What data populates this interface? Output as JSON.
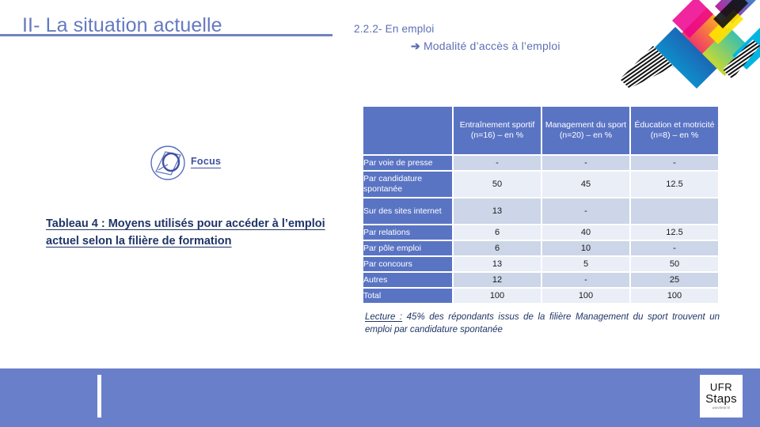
{
  "slide": {
    "title": "II- La situation actuelle",
    "subtitle_number": "2.2.2- En emploi",
    "subtitle_detail": "Modalité d’accès à l’emploi",
    "arrow_glyph": "➔",
    "focus_label": "Focus",
    "table_caption": "Tableau 4 : Moyens utilisés pour accéder à l’emploi actuel selon la filière de formation",
    "lecture_label": "Lecture :",
    "lecture_text": " 45% des répondants issus de la filière Management du sport trouvent un emploi par candidature spontanée"
  },
  "table": {
    "corner_header": "",
    "columns": [
      "Entraînement sportif (n=16) – en %",
      "Management du sport (n=20) – en %",
      "Éducation et motricité (n=8) – en %"
    ],
    "rows": [
      {
        "label": "Par voie de presse",
        "values": [
          "-",
          "-",
          "-"
        ]
      },
      {
        "label": "Par candidature spontanée",
        "values": [
          "50",
          "45",
          "12.5"
        ]
      },
      {
        "label": "Sur des sites internet",
        "values": [
          "13",
          "-",
          ""
        ]
      },
      {
        "label": "Par relations",
        "values": [
          "6",
          "40",
          "12.5"
        ]
      },
      {
        "label": "Par pôle emploi",
        "values": [
          "6",
          "10",
          "-"
        ]
      },
      {
        "label": "Par concours",
        "values": [
          "13",
          "5",
          "50"
        ]
      },
      {
        "label": "Autres",
        "values": [
          "12",
          "-",
          "25"
        ]
      },
      {
        "label": "Total",
        "values": [
          "100",
          "100",
          "100"
        ]
      }
    ]
  },
  "footer": {
    "logo_line1": "UFR",
    "logo_line2": "Staps",
    "logo_sub": "UNIVERSITÉ"
  },
  "colors": {
    "title_blue": "#6679c0",
    "header_fill": "#5a74c4",
    "cell_shade_dark": "#ccd6e8",
    "cell_shade_light": "#e9eef7",
    "caption_navy": "#1f3567",
    "footer_band": "#6a7fca"
  }
}
